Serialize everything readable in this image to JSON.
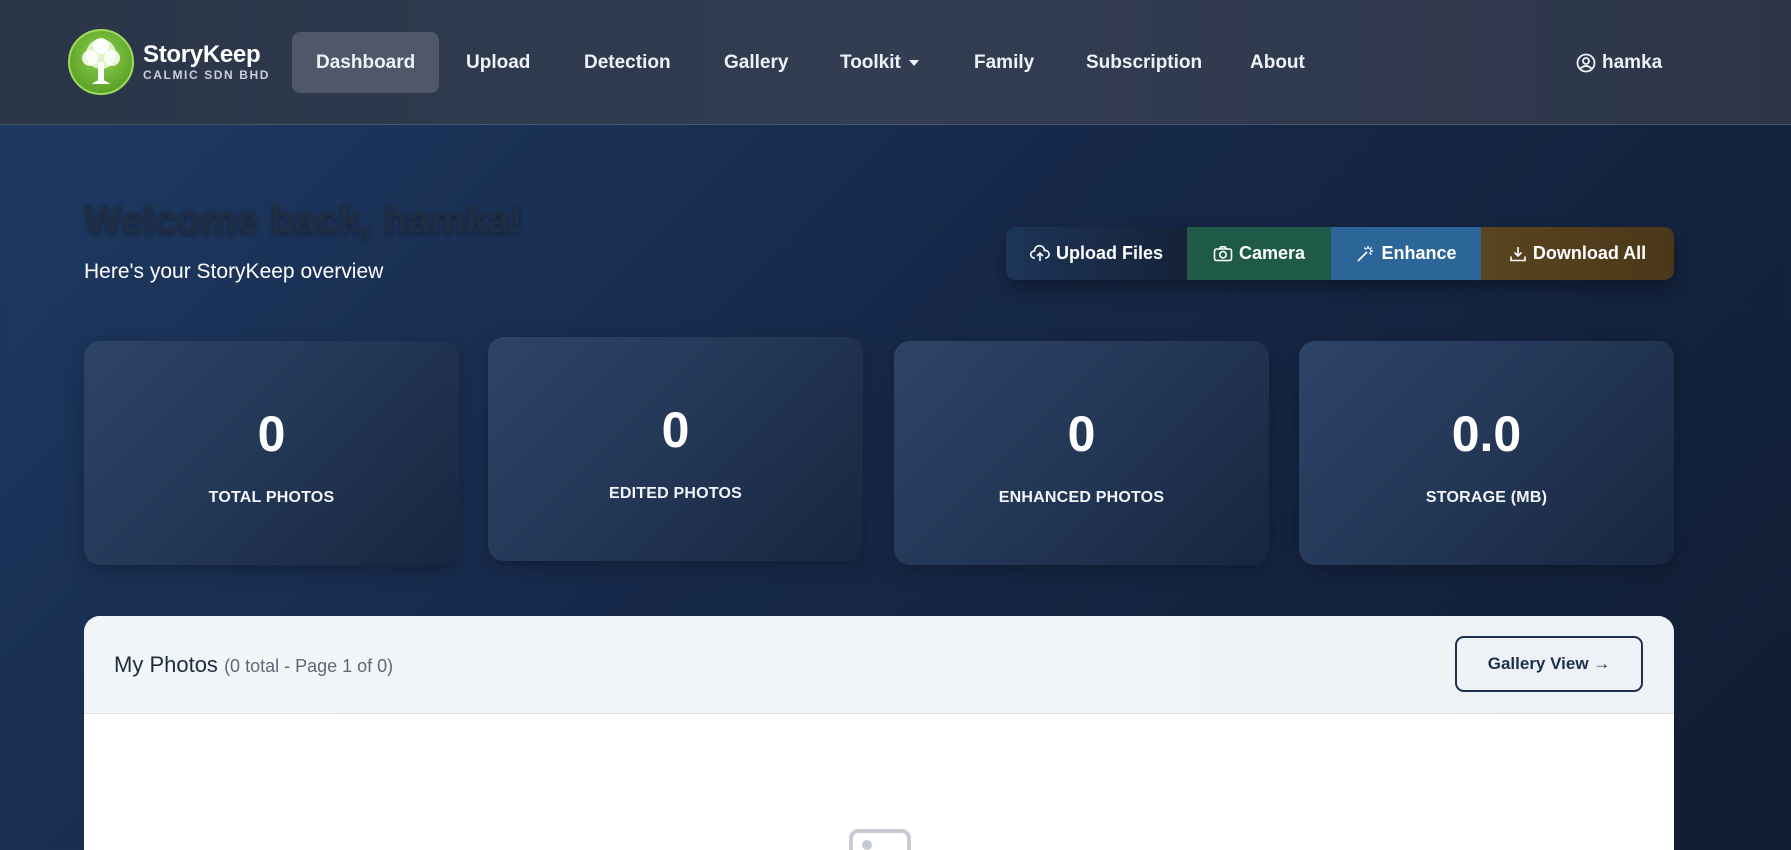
{
  "brand": {
    "name": "StoryKeep",
    "subtitle": "CALMIC SDN BHD"
  },
  "nav": {
    "items": [
      {
        "label": "Dashboard",
        "active": true
      },
      {
        "label": "Upload"
      },
      {
        "label": "Detection"
      },
      {
        "label": "Gallery"
      },
      {
        "label": "Toolkit",
        "dropdown": true
      },
      {
        "label": "Family"
      },
      {
        "label": "Subscription"
      },
      {
        "label": "About"
      }
    ],
    "user": {
      "name": "hamka",
      "icon": "user-circle-icon"
    }
  },
  "hero": {
    "welcome": "Welcome back, hamka!",
    "overview": "Here's your StoryKeep overview"
  },
  "actions": {
    "upload": {
      "label": "Upload Files",
      "icon": "cloud-upload-icon"
    },
    "camera": {
      "label": "Camera",
      "icon": "camera-icon"
    },
    "enhance": {
      "label": "Enhance",
      "icon": "magic-wand-icon"
    },
    "download": {
      "label": "Download All",
      "icon": "download-icon"
    }
  },
  "stats": [
    {
      "value": "0",
      "label": "TOTAL PHOTOS"
    },
    {
      "value": "0",
      "label": "EDITED PHOTOS"
    },
    {
      "value": "0",
      "label": "ENHANCED PHOTOS"
    },
    {
      "value": "0.0",
      "label": "STORAGE (MB)"
    }
  ],
  "photos": {
    "title": "My Photos",
    "meta": "(0 total - Page 1 of 0)",
    "gallery_button": "Gallery View →"
  },
  "colors": {
    "camera": "#1f5a48",
    "enhance": "#2c6598",
    "download": "#5a4420",
    "logo_green": "#5fa52a"
  }
}
